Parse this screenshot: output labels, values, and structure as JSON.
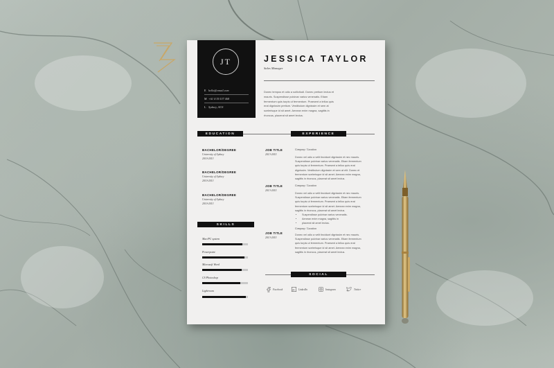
{
  "resume": {
    "monogram": "JT",
    "name": "JESSICA TAYLOR",
    "role": "Sales Manager",
    "contacts": [
      {
        "icon": "email-icon",
        "glyph": "E",
        "value": "hello@email.com"
      },
      {
        "icon": "phone-icon",
        "glyph": "M",
        "value": "+61 4·35·537 468"
      },
      {
        "icon": "location-icon",
        "glyph": "L",
        "value": "Sydney, AUS"
      }
    ],
    "profile": [
      "Donec tempus et odio a sollicitudi. Donec pretium lectus et",
      "mauris. Suspendisse pulvinar varius venenatis. Etiam",
      "fermentum quis turpis ut fermentum. Praesent a tellus quis",
      "erat dignissim pretium. Vestibulum dignissim et sem at",
      "scelerisque id sit amet. Aenean enim magna, sagittis in",
      "rhoncus, placerat sit amet lectus."
    ],
    "sections": {
      "education": "EDUCATION",
      "experience": "EXPERIENCE",
      "skills": "SKILLS",
      "social": "SOCIAL"
    },
    "education": [
      {
        "degree": "BACHELOR/DEGREE",
        "school": "University of Sydney",
        "years": "2010-2013"
      },
      {
        "degree": "BACHELOR/DEGREE",
        "school": "University of Sydney",
        "years": "2010-2013"
      },
      {
        "degree": "BACHELOR/DEGREE",
        "school": "University of Sydney",
        "years": "2010-2013"
      }
    ],
    "skills": [
      {
        "name": "Mac/PC system",
        "level": 0.88
      },
      {
        "name": "Powerpoint",
        "level": 0.92
      },
      {
        "name": "Microsoft Word",
        "level": 0.86
      },
      {
        "name": "CS Photoshop",
        "level": 0.84
      },
      {
        "name": "Lightroom",
        "level": 0.96
      }
    ],
    "experience": [
      {
        "title": "JOB TITLE",
        "years": "2013-2015",
        "company": "Company / Location",
        "desc": [
          "Donec vel odio a velit tincidunt dignissim et nec mauris.",
          "Suspendisse pulvinar varius venenatis. Etiam fermentum",
          "quis turpis ut fermentum. Praesent a tellus quis erat",
          "dignissim. Vestibulum dignissim et sem at elit. Donec et",
          "fermentum scelerisque id sit amet. Aenean enim magna,",
          "sagittis in rhoncus, placerat sit amet lectus."
        ],
        "bullets": []
      },
      {
        "title": "JOB TITLE",
        "years": "2013-2015",
        "company": "Company / Location",
        "desc": [
          "Donec vel odio a velit tincidunt dignissim et nec mauris.",
          "Suspendisse pulvinar varius venenatis. Etiam fermentum",
          "quis turpis ut fermentum. Praesent a tellus quis erat",
          "fermentum scelerisque id sit amet. Aenean enim magna,",
          "sagittis in rhoncus, placerat sit amet lectus."
        ],
        "bullets": [
          "Suspendisse pulvinar varius venenatis.",
          "Aenean enim magna, sagittis in",
          "placerat sit amet lectus."
        ]
      },
      {
        "title": "JOB TITLE",
        "years": "2013-2015",
        "company": "Company / Location",
        "desc": [
          "Donec vel odio a velit tincidunt dignissim et nec mauris.",
          "Suspendisse pulvinar varius venenatis. Etiam fermentum",
          "quis turpis ut fermentum. Praesent a tellus quis erat",
          "fermentum scelerisque id sit amet. Aenean enim magna,",
          "sagittis in rhoncus, placerat sit amet lectus."
        ],
        "bullets": []
      }
    ],
    "social": [
      {
        "icon": "facebook-icon",
        "label": "Facebook"
      },
      {
        "icon": "linkedin-icon",
        "label": "LinkedIn"
      },
      {
        "icon": "instagram-icon",
        "label": "Instagram"
      },
      {
        "icon": "twitter-icon",
        "label": "Twitter"
      }
    ]
  },
  "colors": {
    "accent": "#111111",
    "paper": "#f1f0ef",
    "marble": "#aeb8b1",
    "pen_gold": "#b9964f"
  }
}
